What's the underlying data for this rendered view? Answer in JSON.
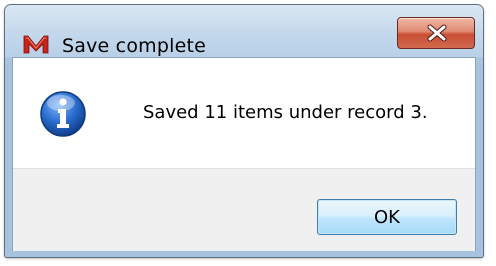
{
  "dialog": {
    "title": "Save complete",
    "message": "Saved 11 items under record 3.",
    "ok_label": "OK"
  },
  "icons": {
    "app_logo": "app-logo-icon",
    "close": "close-icon",
    "info": "information-icon"
  },
  "colors": {
    "close_button_red": "#c94e34",
    "info_icon_blue": "#1f5fbf",
    "ok_button_border": "#3c7fb1"
  }
}
